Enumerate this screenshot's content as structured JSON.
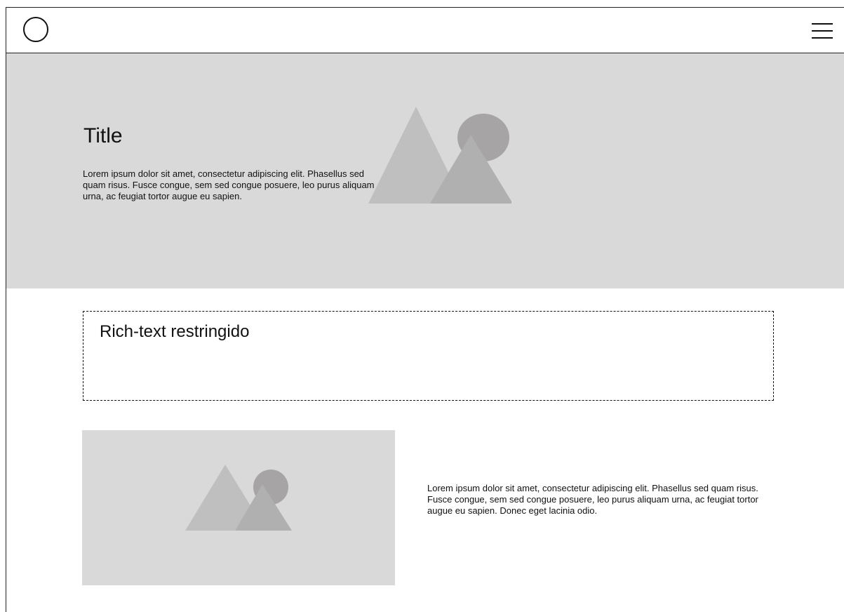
{
  "navbar": {
    "logo_icon": "circle-logo-icon",
    "menu_icon": "hamburger-menu-icon"
  },
  "hero": {
    "title": "Title",
    "text": "Lorem ipsum dolor sit amet, consectetur adipiscing elit. Phasellus sed quam risus. Fusce congue, sem sed congue posuere, leo purus aliquam urna, ac feugiat tortor augue eu sapien.",
    "image_icon": "image-placeholder-icon"
  },
  "richtext": {
    "title": "Rich-text restringido"
  },
  "media": {
    "image_icon": "image-placeholder-icon",
    "text": "Lorem ipsum dolor sit amet, consectetur adipiscing elit. Phasellus sed quam risus. Fusce congue, sem sed congue posuere, leo purus aliquam urna, ac feugiat tortor augue eu sapien. Donec eget lacinia odio."
  },
  "colors": {
    "placeholder_bg": "#d9d9d9",
    "mountain_light": "#bfbfbf",
    "mountain_dark": "#b0b0b0",
    "sun": "#a6a4a4",
    "line": "#111111"
  }
}
